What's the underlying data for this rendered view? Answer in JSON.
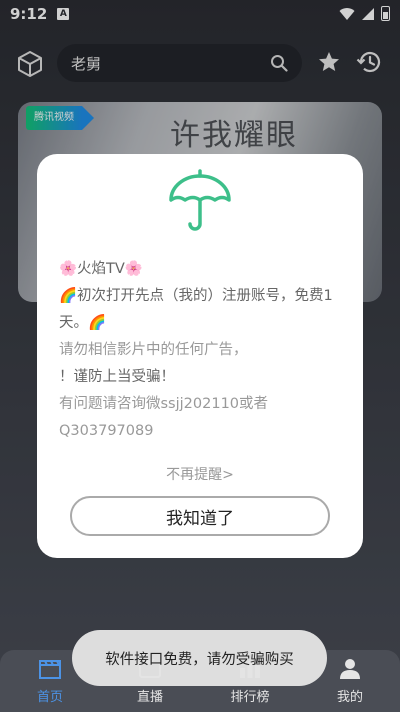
{
  "status_bar": {
    "time": "9:12",
    "notif_glyph": "A"
  },
  "search": {
    "query": "老舅"
  },
  "banner": {
    "tag": "腾讯视频",
    "poster_text": "许我耀眼"
  },
  "dialog": {
    "lines": [
      {
        "text": "🌸火焰TV🌸",
        "style": "dark"
      },
      {
        "text": "🌈初次打开先点（我的）注册账号，免费1",
        "style": "dark"
      },
      {
        "text": "天。🌈",
        "style": "dark"
      },
      {
        "text": "请勿相信影片中的任何广告，",
        "style": "light"
      },
      {
        "text": "！谨防上当受骗！",
        "style": "dark"
      },
      {
        "text": "有问题请咨询微ssjj202110或者",
        "style": "light"
      },
      {
        "text": "Q303797089",
        "style": "light"
      }
    ],
    "dismiss_label": "不再提醒>",
    "ok_label": "我知道了",
    "accent_color": "#3dbf8a"
  },
  "nav": {
    "items": [
      {
        "label": "首页",
        "icon": "clapperboard-icon",
        "active": true
      },
      {
        "label": "直播",
        "icon": "tv-icon",
        "active": false
      },
      {
        "label": "排行榜",
        "icon": "ranking-icon",
        "active": false
      },
      {
        "label": "我的",
        "icon": "person-icon",
        "active": false
      }
    ],
    "active_color": "#4c93e6"
  },
  "toast": {
    "text": "软件接口免费，请勿受骗购买"
  }
}
